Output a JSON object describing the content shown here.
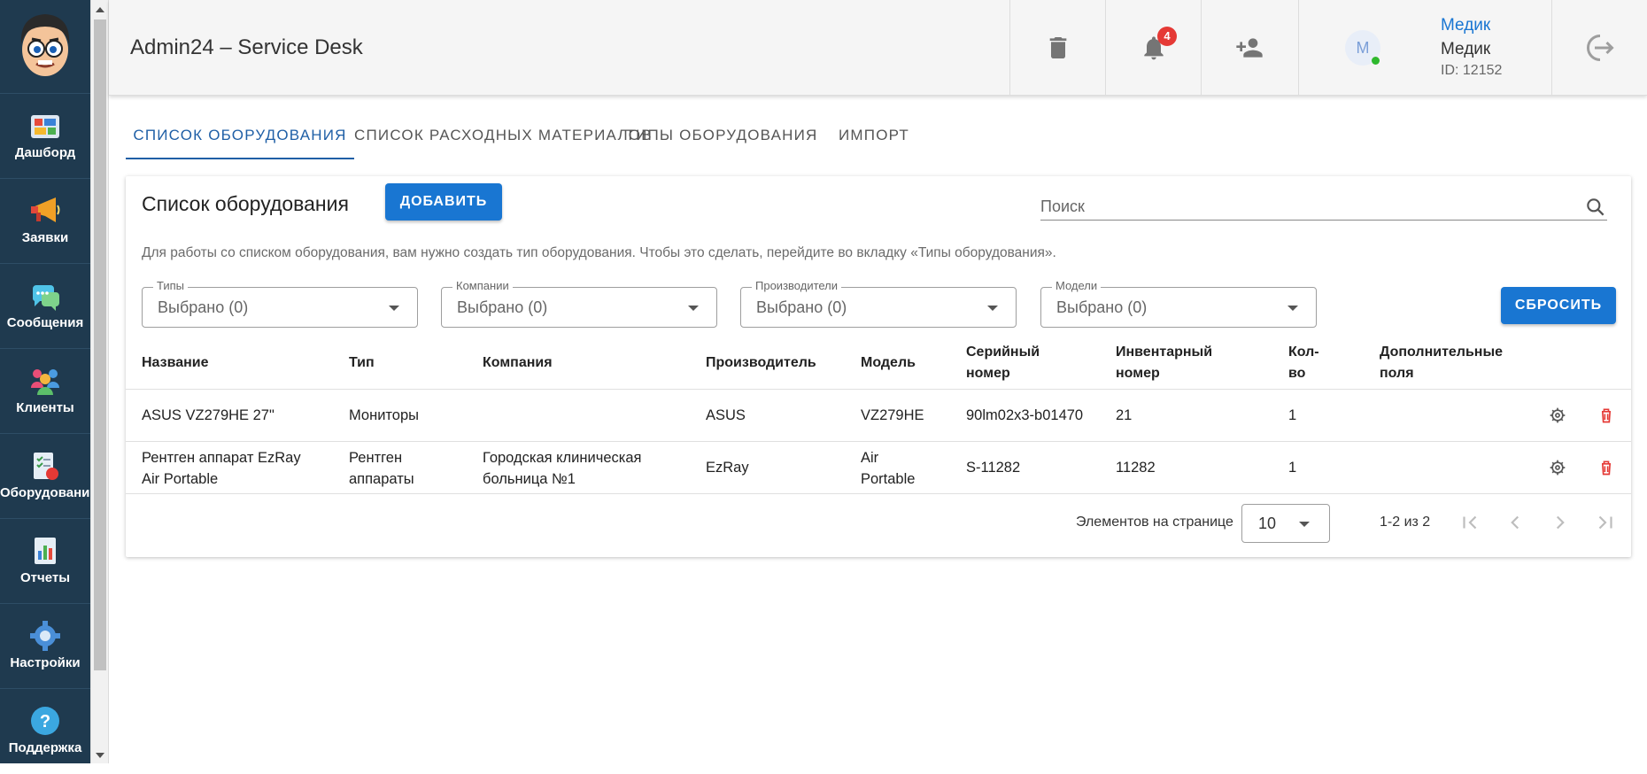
{
  "sidebar": {
    "items": [
      {
        "label": "Дашборд",
        "icon": "dashboard-icon"
      },
      {
        "label": "Заявки",
        "icon": "megaphone-icon"
      },
      {
        "label": "Сообщения",
        "icon": "chat-icon"
      },
      {
        "label": "Клиенты",
        "icon": "clients-icon"
      },
      {
        "label": "Оборудование",
        "icon": "equipment-icon"
      },
      {
        "label": "Отчеты",
        "icon": "reports-icon"
      },
      {
        "label": "Настройки",
        "icon": "settings-icon"
      },
      {
        "label": "Поддержка",
        "icon": "help-icon"
      }
    ]
  },
  "header": {
    "title": "Admin24 – Service Desk",
    "notification_count": "4",
    "user": {
      "avatar_letter": "М",
      "link": "Медик",
      "name": "Медик",
      "id": "ID: 12152"
    }
  },
  "tabs": [
    {
      "label": "СПИСОК ОБОРУДОВАНИЯ",
      "active": true
    },
    {
      "label": "СПИСОК РАСХОДНЫХ МАТЕРИАЛОВ",
      "active": false
    },
    {
      "label": "ТИПЫ ОБОРУДОВАНИЯ",
      "active": false
    },
    {
      "label": "ИМПОРТ",
      "active": false
    }
  ],
  "card": {
    "title": "Список оборудования",
    "add_label": "ДОБАВИТЬ",
    "search_placeholder": "Поиск",
    "hint": "Для работы со списком оборудования, вам нужно создать тип оборудования. Чтобы это сделать, перейдите во вкладку «Типы оборудования».",
    "reset_label": "СБРОСИТЬ",
    "filters": [
      {
        "label": "Типы",
        "value": "Выбрано (0)"
      },
      {
        "label": "Компании",
        "value": "Выбрано (0)"
      },
      {
        "label": "Производители",
        "value": "Выбрано (0)"
      },
      {
        "label": "Модели",
        "value": "Выбрано (0)"
      }
    ]
  },
  "table": {
    "columns": [
      "Название",
      "Тип",
      "Компания",
      "Производитель",
      "Модель",
      "Серийный номер",
      "Инвентарный номер",
      "Кол-во",
      "Дополнительные поля"
    ],
    "rows": [
      [
        "ASUS VZ279HE 27\"",
        "Мониторы",
        "",
        "ASUS",
        "VZ279HE",
        "90lm02x3-b01470",
        "21",
        "1",
        ""
      ],
      [
        "Рентген аппарат EzRay Air Portable",
        "Рентген аппараты",
        "Городская клиническая больница №1",
        "EzRay",
        "Air Portable",
        "S-11282",
        "11282",
        "1",
        ""
      ]
    ]
  },
  "pagination": {
    "per_page_label": "Элементов на странице",
    "per_page_value": "10",
    "range": "1-2 из 2"
  },
  "colors": {
    "accent": "#1976d2",
    "sidebar_bg": "#1f3a4f",
    "delete_red": "#e53935",
    "badge_red": "#e53935"
  }
}
